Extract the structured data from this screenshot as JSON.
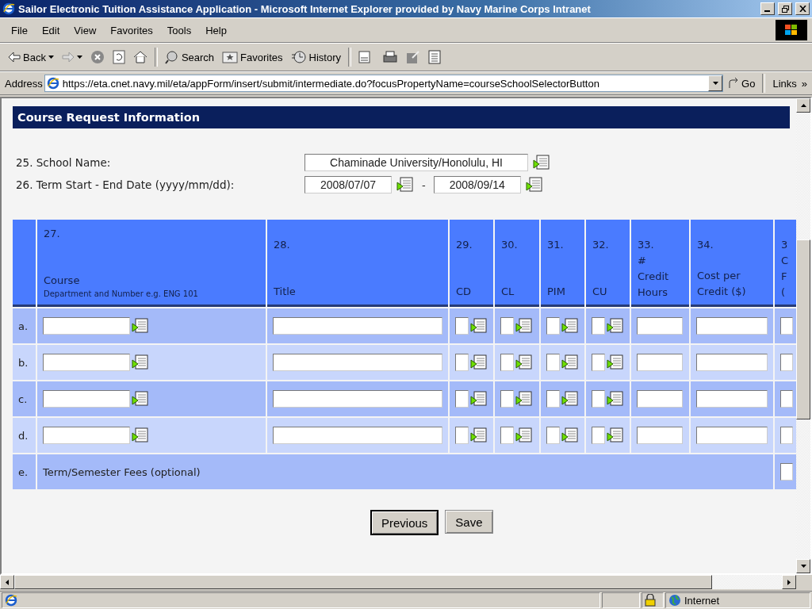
{
  "window": {
    "title": "Sailor Electronic Tuition Assistance Application - Microsoft Internet Explorer provided by Navy Marine Corps Intranet"
  },
  "menu": [
    "File",
    "Edit",
    "View",
    "Favorites",
    "Tools",
    "Help"
  ],
  "toolbar": [
    {
      "kind": "back",
      "label": "Back"
    },
    {
      "kind": "forward"
    },
    {
      "kind": "stop"
    },
    {
      "kind": "refresh"
    },
    {
      "kind": "home"
    },
    {
      "kind": "separator"
    },
    {
      "kind": "search",
      "label": "Search"
    },
    {
      "kind": "favorites",
      "label": "Favorites"
    },
    {
      "kind": "history",
      "label": "History"
    },
    {
      "kind": "separator"
    },
    {
      "kind": "mail"
    },
    {
      "kind": "print"
    },
    {
      "kind": "edit"
    },
    {
      "kind": "discuss"
    }
  ],
  "address_bar": {
    "label": "Address",
    "url": "https://eta.cnet.navy.mil/eta/appForm/insert/submit/intermediate.do?focusPropertyName=courseSchoolSelectorButton",
    "go": "Go",
    "links": "Links",
    "links_more": "»"
  },
  "section": {
    "title": "Course Request Information"
  },
  "form": {
    "school": {
      "label": "25. School Name:",
      "value": "Chaminade University/Honolulu, HI"
    },
    "term": {
      "label": "26. Term Start - End Date (yyyy/mm/dd):",
      "start": "2008/07/07",
      "separator": "-",
      "end": "2008/09/14"
    }
  },
  "table": {
    "columns": [
      {
        "kind": "label"
      },
      {
        "kind": "course",
        "number": "27.",
        "lines": [
          "Course"
        ],
        "note": "Department and Number e.g. ENG 101"
      },
      {
        "kind": "title",
        "number": "28.",
        "lines": [
          "Title"
        ]
      },
      {
        "kind": "code",
        "number": "29.",
        "lines": [
          "CD"
        ]
      },
      {
        "kind": "code",
        "number": "30.",
        "lines": [
          "CL"
        ]
      },
      {
        "kind": "code",
        "number": "31.",
        "lines": [
          "PIM"
        ]
      },
      {
        "kind": "code",
        "number": "32.",
        "lines": [
          "CU"
        ]
      },
      {
        "kind": "number",
        "number": "33.",
        "lines": [
          "#",
          "Credit",
          "Hours"
        ]
      },
      {
        "kind": "money",
        "number": "34.",
        "lines": [
          "Cost per",
          "Credit ($)"
        ]
      },
      {
        "kind": "cut",
        "number": "3",
        "lines": [
          "C",
          "F",
          "("
        ]
      }
    ],
    "rows": [
      {
        "label": "a."
      },
      {
        "label": "b."
      },
      {
        "label": "c."
      },
      {
        "label": "d."
      }
    ],
    "fees_row": {
      "label": "e.",
      "text": "Term/Semester Fees (optional)"
    }
  },
  "buttons": [
    {
      "label": "Previous",
      "default": true
    },
    {
      "label": "Save",
      "default": false
    }
  ],
  "status_bar": {
    "zone": "Internet"
  }
}
